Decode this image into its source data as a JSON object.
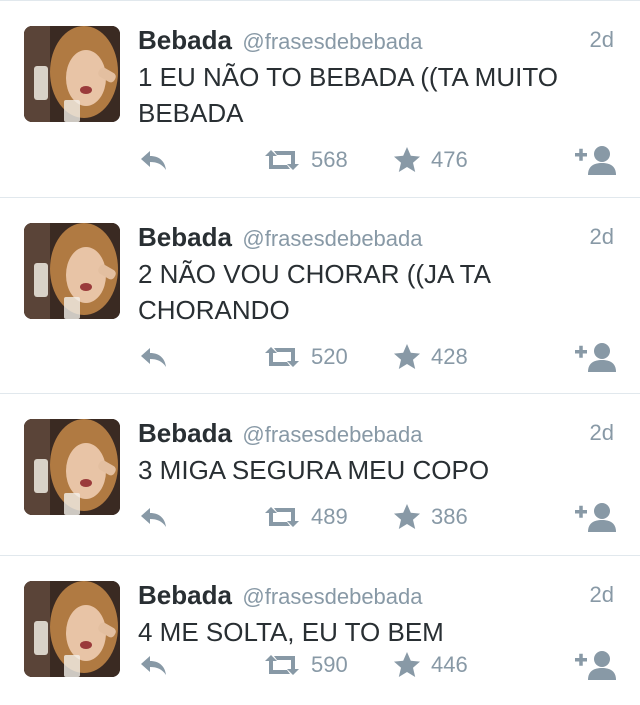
{
  "tweets": [
    {
      "name": "Bebada",
      "handle": "@frasesdebebada",
      "time": "2d",
      "text": "1 EU NÃO TO BEBADA ((TA MUITO BEBADA",
      "retweets": "568",
      "favorites": "476"
    },
    {
      "name": "Bebada",
      "handle": "@frasesdebebada",
      "time": "2d",
      "text": "2 NÃO VOU CHORAR ((JA TA CHORANDO",
      "retweets": "520",
      "favorites": "428"
    },
    {
      "name": "Bebada",
      "handle": "@frasesdebebada",
      "time": "2d",
      "text": "3 MIGA SEGURA MEU COPO",
      "retweets": "489",
      "favorites": "386"
    },
    {
      "name": "Bebada",
      "handle": "@frasesdebebada",
      "time": "2d",
      "text": "4 ME SOLTA, EU TO BEM",
      "retweets": "590",
      "favorites": "446"
    }
  ],
  "icons": {
    "reply": "reply-icon",
    "retweet": "retweet-icon",
    "favorite": "star-icon",
    "follow": "follow-user-icon",
    "avatar": "avatar-photo"
  },
  "colors": {
    "text": "#292f33",
    "muted": "#8899a6",
    "divider": "#e1e8ed"
  }
}
